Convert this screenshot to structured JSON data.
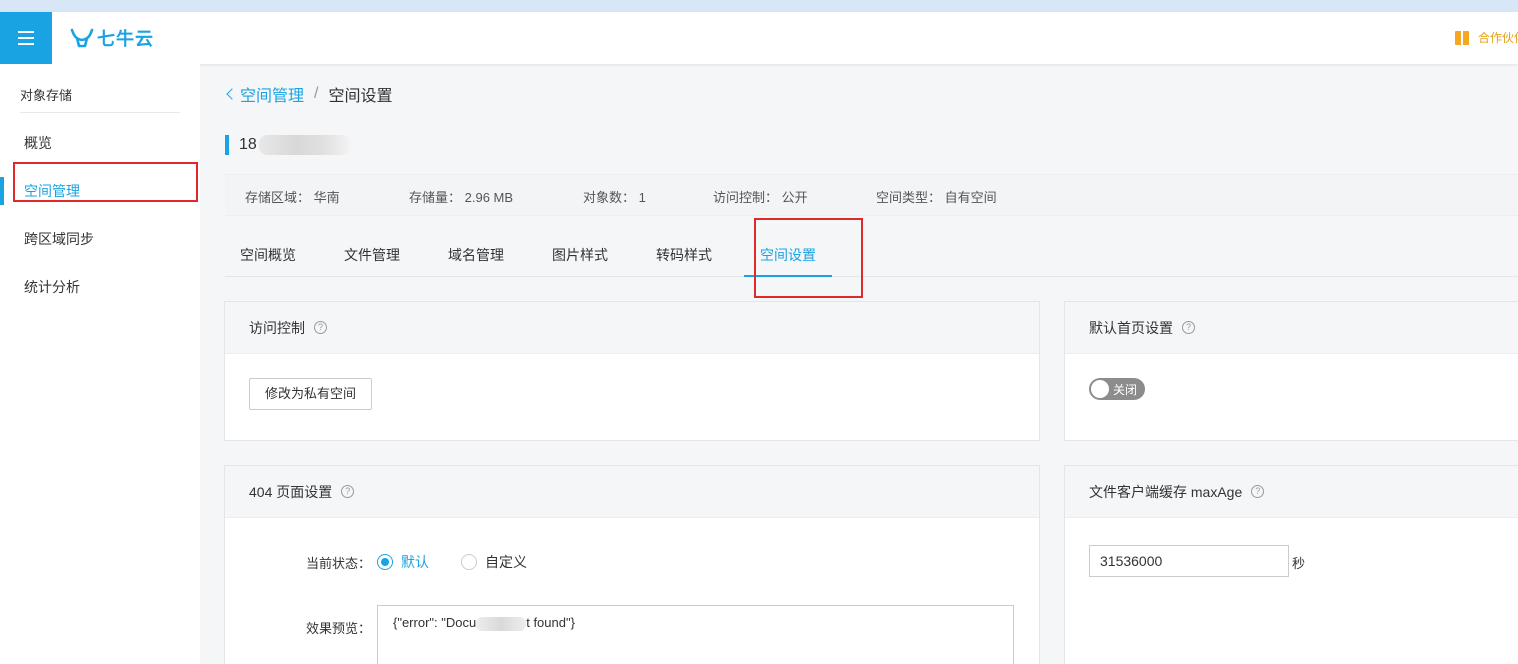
{
  "header": {
    "logo_text": "七牛云",
    "partner_label": "合作伙伴"
  },
  "sidebar": {
    "section_title": "对象存储",
    "items": [
      {
        "label": "概览"
      },
      {
        "label": "空间管理",
        "active": true
      },
      {
        "label": "跨区域同步"
      },
      {
        "label": "统计分析"
      }
    ]
  },
  "breadcrumb": {
    "parent": "空间管理",
    "separator": "/",
    "current": "空间设置"
  },
  "bucket": {
    "name_visible": "18"
  },
  "info": {
    "region_label": "存储区域：",
    "region_value": "华南",
    "storage_label": "存储量：",
    "storage_value": "2.96 MB",
    "objects_label": "对象数：",
    "objects_value": "1",
    "access_label": "访问控制：",
    "access_value": "公开",
    "type_label": "空间类型：",
    "type_value": "自有空间"
  },
  "tabs": [
    {
      "label": "空间概览"
    },
    {
      "label": "文件管理"
    },
    {
      "label": "域名管理"
    },
    {
      "label": "图片样式"
    },
    {
      "label": "转码样式"
    },
    {
      "label": "空间设置",
      "active": true
    }
  ],
  "access_card": {
    "title": "访问控制",
    "button_label": "修改为私有空间"
  },
  "homepage_card": {
    "title": "默认首页设置",
    "toggle_label": "关闭",
    "toggle_on": false
  },
  "page404_card": {
    "title": "404 页面设置",
    "status_label": "当前状态：",
    "option_default": "默认",
    "option_custom": "自定义",
    "selected": "默认",
    "preview_label": "效果预览：",
    "preview_before": "{\"error\": \"Docu",
    "preview_after": "t found\"}"
  },
  "cache_card": {
    "title": "文件客户端缓存 maxAge",
    "value": "31536000",
    "unit": "秒"
  },
  "colors": {
    "accent": "#1aa3e3",
    "highlight_box": "#e0292a"
  }
}
